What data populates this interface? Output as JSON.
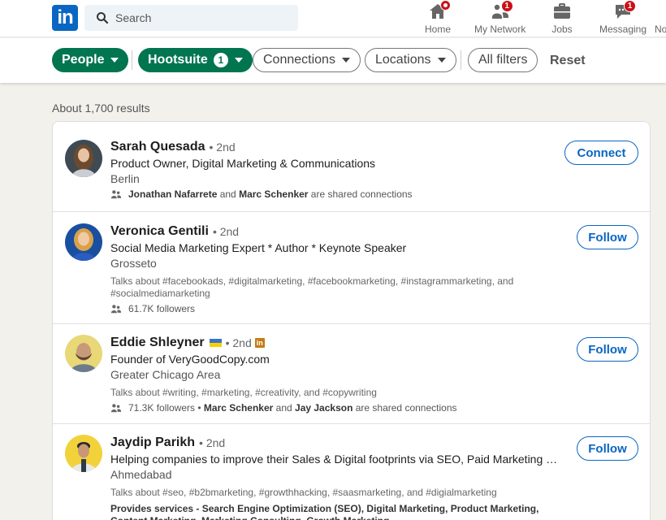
{
  "nav": {
    "logo_text": "in",
    "search_placeholder": "Search",
    "items": [
      {
        "label": "Home",
        "badge": ""
      },
      {
        "label": "My Network",
        "badge": "1"
      },
      {
        "label": "Jobs",
        "badge": ""
      },
      {
        "label": "Messaging",
        "badge": "1"
      },
      {
        "label": "No"
      }
    ]
  },
  "filters": {
    "people": "People",
    "hootsuite": "Hootsuite",
    "hootsuite_count": "1",
    "connections": "Connections",
    "locations": "Locations",
    "all_filters": "All filters",
    "reset": "Reset"
  },
  "results_count": "About 1,700 results",
  "results": [
    {
      "name": "Sarah Quesada",
      "degree": "• 2nd",
      "headline": "Product Owner, Digital Marketing & Communications",
      "location": "Berlin",
      "meta_bold1": "Jonathan Nafarrete",
      "meta_and": " and ",
      "meta_bold2": "Marc Schenker",
      "meta_tail": " are shared connections",
      "action": "Connect"
    },
    {
      "name": "Veronica Gentili",
      "degree": "• 2nd",
      "headline": "Social Media Marketing Expert * Author * Keynote Speaker",
      "location": "Grosseto",
      "talks": "Talks about #facebookads, #digitalmarketing, #facebookmarketing, #instagrammarketing, and #socialmediamarketing",
      "followers": "61.7K followers",
      "action": "Follow"
    },
    {
      "name": "Eddie Shleyner",
      "degree": "• 2nd",
      "headline": "Founder of VeryGoodCopy.com",
      "location": "Greater Chicago Area",
      "talks": "Talks about #writing, #marketing, #creativity, and #copywriting",
      "followers": "71.3K followers",
      "meta_sep": " • ",
      "meta_bold1": "Marc Schenker",
      "meta_and": " and ",
      "meta_bold2": "Jay Jackson",
      "meta_tail": " are shared connections",
      "in_badge": "in",
      "action": "Follow"
    },
    {
      "name": "Jaydip Parikh",
      "degree": "• 2nd",
      "headline": "Helping companies to improve their Sales & Digital footprints via SEO, Paid Marketing and Branding",
      "location": "Ahmedabad",
      "talks": "Talks about #seo, #b2bmarketing, #growthhacking, #saasmarketing, and #digialmarketing",
      "services": "Provides services - Search Engine Optimization (SEO), Digital Marketing, Product Marketing, Content Marketing, Marketing Consulting, Growth Marketing",
      "action": "Follow"
    }
  ],
  "colors": {
    "brand": "#0a66c2",
    "filter_active": "#01754f",
    "badge": "#cc1016",
    "background": "#f3f1ec"
  }
}
